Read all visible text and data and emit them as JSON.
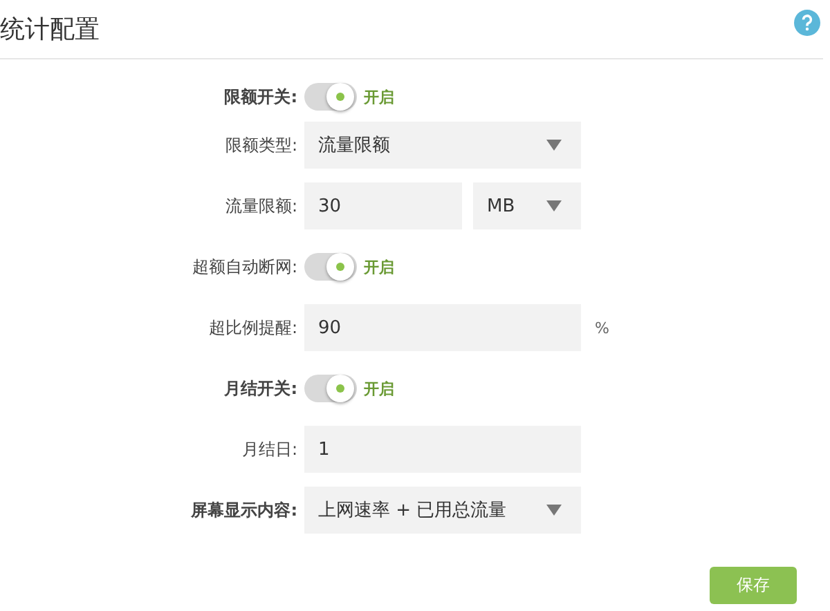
{
  "header": {
    "title": "统计配置"
  },
  "rows": [
    {
      "kind": "toggle",
      "label": "限额开关:",
      "bold": true,
      "on": true,
      "state_text": "开启"
    },
    {
      "kind": "select",
      "label": "限额类型:",
      "bold": false,
      "value": "流量限额"
    },
    {
      "kind": "input_select",
      "label": "流量限额:",
      "bold": false,
      "value": "30",
      "unit": "MB"
    },
    {
      "kind": "toggle",
      "label": "超额自动断网:",
      "bold": false,
      "on": true,
      "state_text": "开启"
    },
    {
      "kind": "input",
      "label": "超比例提醒:",
      "bold": false,
      "value": "90",
      "suffix": "%"
    },
    {
      "kind": "toggle",
      "label": "月结开关:",
      "bold": true,
      "on": true,
      "state_text": "开启"
    },
    {
      "kind": "input",
      "label": "月结日:",
      "bold": false,
      "value": "1"
    },
    {
      "kind": "select",
      "label": "屏幕显示内容:",
      "bold": true,
      "value": "上网速率 + 已用总流量"
    }
  ],
  "save_button": "保存"
}
